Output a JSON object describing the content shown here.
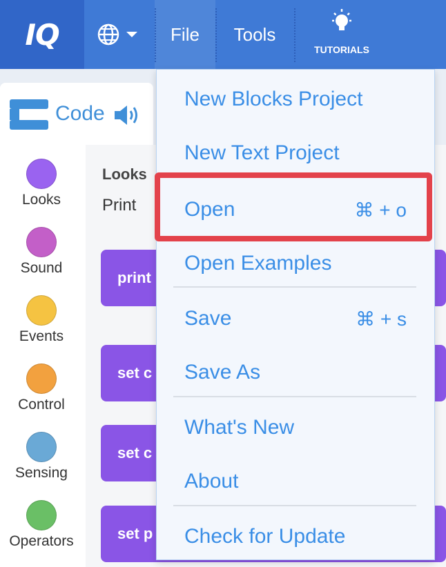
{
  "topbar": {
    "logo_text": "IQ",
    "file_label": "File",
    "tools_label": "Tools",
    "tutorials_label": "TUTORIALS"
  },
  "code_tab": {
    "label": "Code"
  },
  "categories": [
    {
      "label": "Looks",
      "color": "#9a63f0"
    },
    {
      "label": "Sound",
      "color": "#c35fc8"
    },
    {
      "label": "Events",
      "color": "#f5c342"
    },
    {
      "label": "Control",
      "color": "#f2a13f"
    },
    {
      "label": "Sensing",
      "color": "#6aa9d6"
    },
    {
      "label": "Operators",
      "color": "#6abf66"
    }
  ],
  "palette": {
    "title": "Looks",
    "subtitle": "Print",
    "blocks": [
      "print",
      "set c",
      "set c",
      "set p"
    ]
  },
  "file_menu": {
    "items": [
      {
        "label": "New Blocks Project",
        "shortcut": ""
      },
      {
        "label": "New Text Project",
        "shortcut": ""
      },
      {
        "label": "Open",
        "shortcut": "⌘ + o"
      },
      {
        "label": "Open Examples",
        "shortcut": ""
      },
      {
        "label": "Save",
        "shortcut": "⌘ + s"
      },
      {
        "label": "Save As",
        "shortcut": ""
      },
      {
        "label": "What's New",
        "shortcut": ""
      },
      {
        "label": "About",
        "shortcut": ""
      },
      {
        "label": "Check for Update",
        "shortcut": ""
      }
    ]
  },
  "colors": {
    "topbar": "#3f7ad6",
    "menu_text": "#3a8ee6",
    "highlight": "#e3424b",
    "block": "#8a55e6"
  }
}
